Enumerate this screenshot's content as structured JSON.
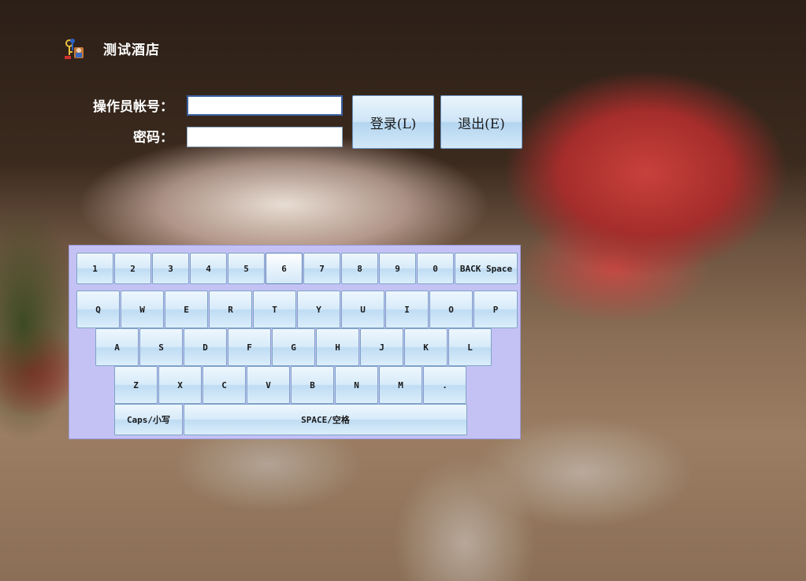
{
  "app": {
    "title": "测试酒店",
    "logo_icon": "keys-user-icon"
  },
  "login": {
    "account_label": "操作员帐号：",
    "account_value": "",
    "password_label": "密码：",
    "password_value": "",
    "login_button": "登录(L)",
    "exit_button": "退出(E)"
  },
  "keyboard": {
    "active_key": "6",
    "row1": [
      "1",
      "2",
      "3",
      "4",
      "5",
      "6",
      "7",
      "8",
      "9",
      "0",
      "BACK Space"
    ],
    "row2": [
      "Q",
      "W",
      "E",
      "R",
      "T",
      "Y",
      "U",
      "I",
      "O",
      "P"
    ],
    "row3": [
      "A",
      "S",
      "D",
      "F",
      "G",
      "H",
      "J",
      "K",
      "L"
    ],
    "row4": [
      "Z",
      "X",
      "C",
      "V",
      "B",
      "N",
      "M",
      "."
    ],
    "row5": [
      "Caps/小写",
      "SPACE/空格"
    ]
  },
  "colors": {
    "keyboard_bg": "#c4c2f4",
    "key_border": "#7fa2c8",
    "button_gradient_top": "#e9f4fc",
    "button_gradient_bottom": "#b4d5f0"
  }
}
